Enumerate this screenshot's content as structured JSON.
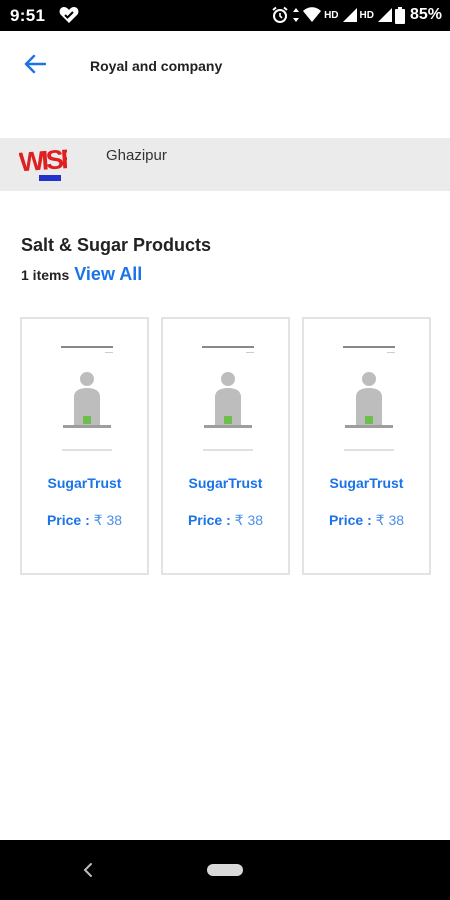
{
  "status_bar": {
    "time": "9:51",
    "hd1": "HD",
    "hd2": "HD",
    "battery": "85%",
    "icons": [
      "heart-icon",
      "alarm-icon",
      "wifi-icon",
      "signal-icon",
      "battery-icon"
    ]
  },
  "header": {
    "title": "Royal and company",
    "back_icon": "arrow-back-icon"
  },
  "store": {
    "logo_text": "WISE",
    "location": "Ghazipur"
  },
  "section": {
    "title": "Salt & Sugar Products",
    "count": "1 items",
    "view_all": "View All"
  },
  "products": [
    {
      "name": "SugarTrust",
      "price_label": "Price :",
      "price_value": "₹ 38"
    },
    {
      "name": "SugarTrust",
      "price_label": "Price :",
      "price_value": "₹ 38"
    },
    {
      "name": "SugarTrust",
      "price_label": "Price :",
      "price_value": "₹ 38"
    }
  ],
  "colors": {
    "accent": "#1a73e8",
    "strip_bg": "#ebebeb",
    "status_bg": "#000000"
  }
}
